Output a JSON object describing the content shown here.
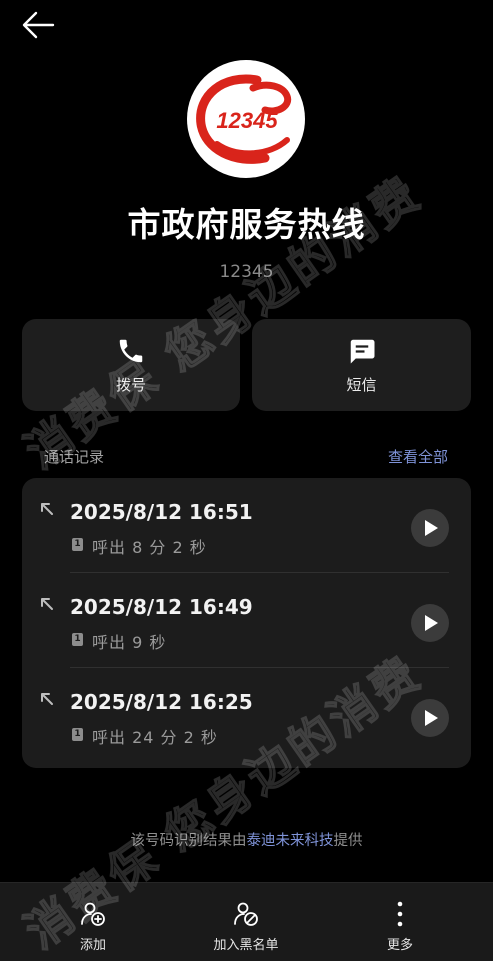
{
  "contact": {
    "name": "市政府服务热线",
    "number": "12345",
    "logo_text": "12345"
  },
  "actions": {
    "call_label": "拨号",
    "sms_label": "短信"
  },
  "call_log": {
    "title": "通话记录",
    "view_all": "查看全部",
    "entries": [
      {
        "time": "2025/8/12 16:51",
        "sim": "1",
        "detail": "呼出 8 分 2 秒"
      },
      {
        "time": "2025/8/12 16:49",
        "sim": "1",
        "detail": "呼出 9 秒"
      },
      {
        "time": "2025/8/12 16:25",
        "sim": "1",
        "detail": "呼出 24 分 2 秒"
      }
    ]
  },
  "provider": {
    "prefix": "该号码识别结果由",
    "name": "泰迪未来科技",
    "suffix": "提供"
  },
  "bottom_bar": {
    "add_label": "添加",
    "blacklist_label": "加入黑名单",
    "more_label": "更多"
  },
  "watermark": {
    "text": "消费保 您身边的消费"
  },
  "colors": {
    "background": "#000000",
    "card": "#1e1e1e",
    "accent": "#7f93d8",
    "logo_red": "#d9241b"
  }
}
